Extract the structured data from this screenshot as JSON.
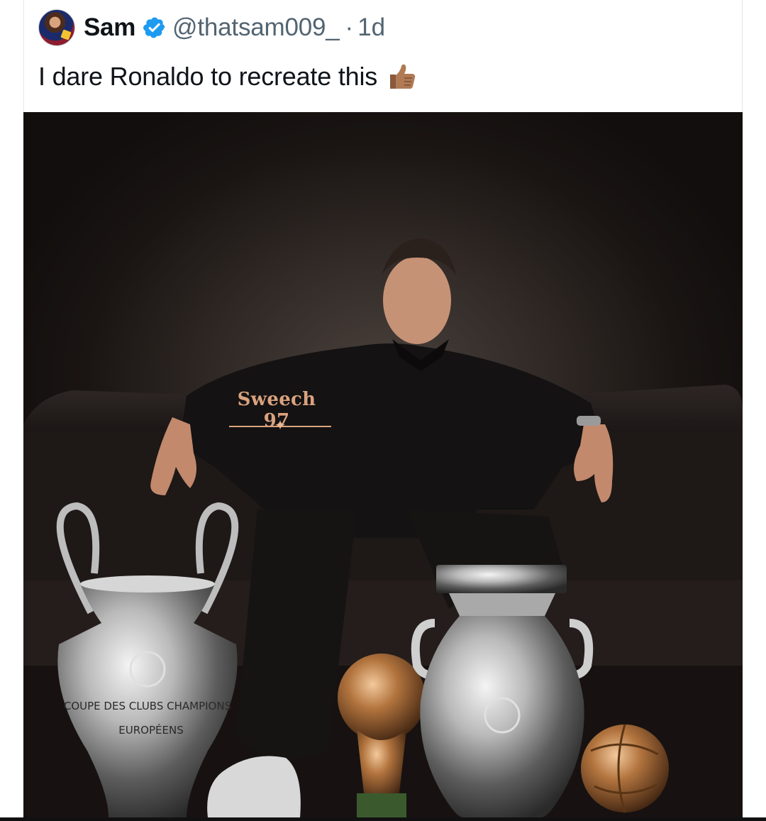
{
  "tweet": {
    "author_name": "Sam",
    "handle": "@thatsam009_",
    "separator": "·",
    "timestamp": "1d",
    "text": "I dare Ronaldo to recreate this",
    "emoji_icon": "thumbs-up-icon"
  },
  "media": {
    "watermark": "Sweech 97",
    "trophy_text": {
      "champions_league_line1": "COUPE DES CLUBS CHAMPIONS",
      "champions_league_line2": "EUROPÉENS"
    }
  },
  "colors": {
    "verified_badge": "#1d9bf0",
    "handle_gray": "#536471",
    "watermark": "#d9a27f"
  }
}
